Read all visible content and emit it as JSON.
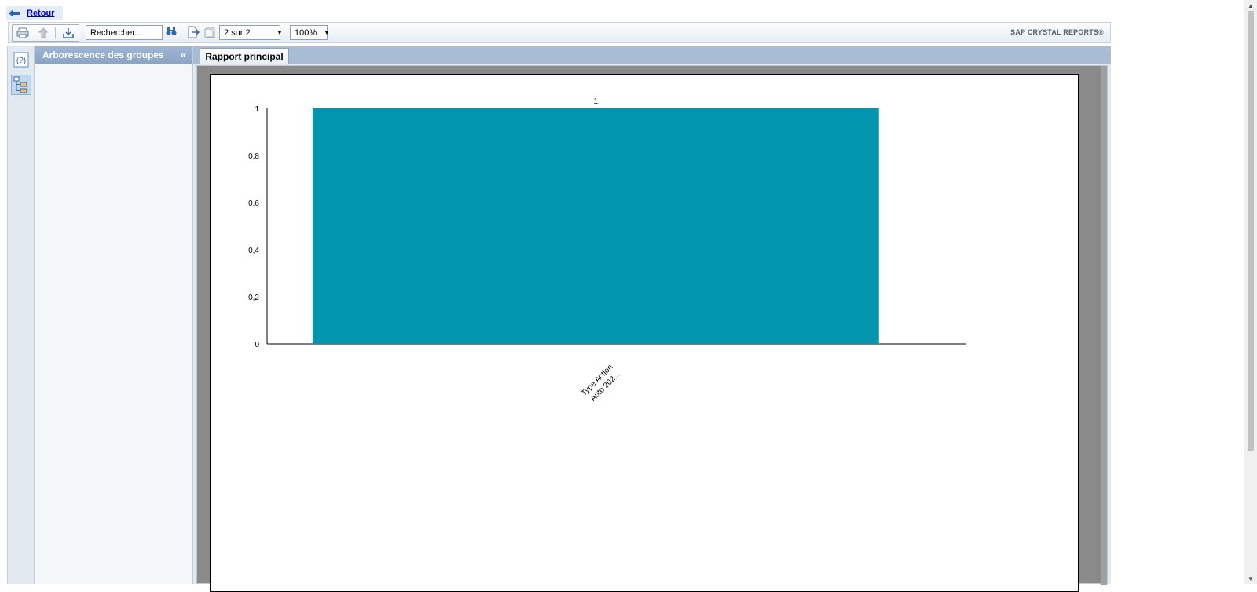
{
  "nav": {
    "back_label": "Retour"
  },
  "toolbar": {
    "search_placeholder": "Rechercher...",
    "page_value": "2 sur 2",
    "zoom_value": "100%",
    "brand": "SAP CRYSTAL REPORTS®"
  },
  "sidebar": {
    "title": "Arborescence des groupes"
  },
  "tabs": [
    {
      "label": "Rapport principal",
      "active": true
    }
  ],
  "chart_data": {
    "type": "bar",
    "categories": [
      "Type Action Auto 202..."
    ],
    "category_label_lines": [
      "Type Action",
      "Auto 202..."
    ],
    "values": [
      1
    ],
    "data_labels": [
      "1"
    ],
    "yticks": [
      "0",
      "0,2",
      "0,4",
      "0,6",
      "0,8",
      "1"
    ],
    "ylim": [
      0,
      1
    ],
    "bar_color": "#0195ae",
    "title": "",
    "xlabel": "",
    "ylabel": ""
  },
  "colors": {
    "accent": "#0195ae",
    "panel_header": "#8aa4c6",
    "link": "#0000cc"
  }
}
